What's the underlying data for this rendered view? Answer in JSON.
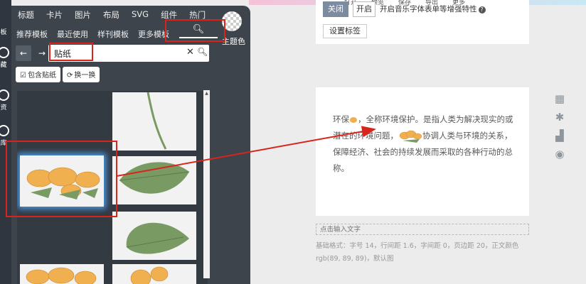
{
  "left_strip": {
    "items": [
      {
        "label": "板"
      },
      {
        "label": "藏"
      },
      {
        "label": "资"
      },
      {
        "label": "库"
      }
    ]
  },
  "panel": {
    "top_tabs": [
      "标题",
      "卡片",
      "图片",
      "布局",
      "SVG",
      "组件",
      "热门"
    ],
    "sub_tabs": [
      "推荐模板",
      "最近使用",
      "样刊模板",
      "更多模板"
    ],
    "theme_label": "主题色",
    "search": {
      "value": "贴纸",
      "placeholder": ""
    },
    "filter_buttons": {
      "include_sticker": "包含贴纸",
      "refresh": "换一换"
    }
  },
  "top_card": {
    "menu_labels": [
      "打开",
      "预览",
      "保存",
      "导出",
      "更多"
    ],
    "close_label": "关闭",
    "open_label": "开启",
    "open_description": "开启音乐字体表单等增强特性",
    "settings_label": "设置标签"
  },
  "editor": {
    "text_1": "环保",
    "text_2": "，全称环境保护。是指人类为解决现实的或潜在的环境问题，",
    "text_3": "协调人类与环境的关系，保障经济、社会的持续发展而采取的各种行动的总称。"
  },
  "input_bar": {
    "placeholder": "点击输入文字"
  },
  "base_format": "基础格式：字号 14，行间距 1.6，字间距 0，页边距 20，正文颜色 rgb(89, 89, 89)，默认图",
  "side_icons": [
    "grid-icon",
    "asterisk-icon",
    "bar-chart-icon",
    "eye-icon"
  ],
  "colors": {
    "panel_bg": "#3d444c",
    "annotation_red": "#d9241c",
    "leaf_green": "#7a9a64",
    "flower_orange": "#f0b050"
  }
}
